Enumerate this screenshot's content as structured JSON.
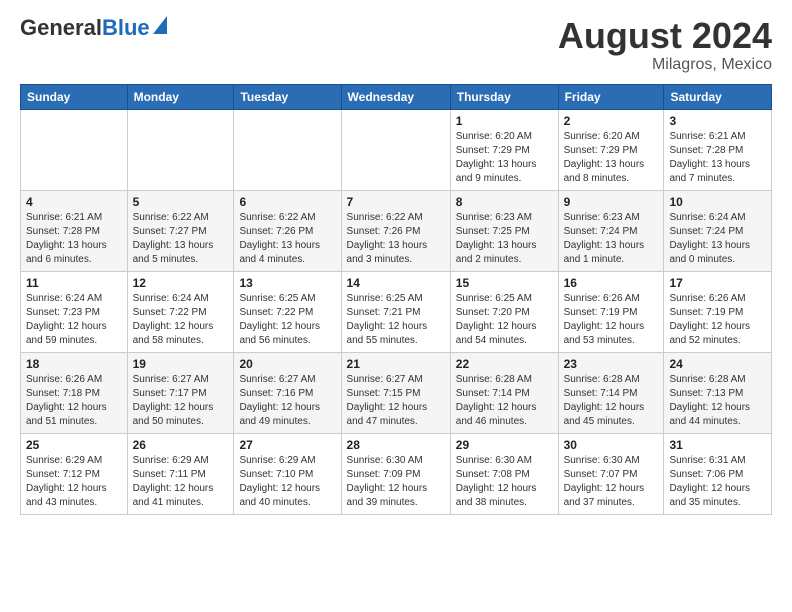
{
  "header": {
    "logo_general": "General",
    "logo_blue": "Blue",
    "month_title": "August 2024",
    "location": "Milagros, Mexico"
  },
  "days_of_week": [
    "Sunday",
    "Monday",
    "Tuesday",
    "Wednesday",
    "Thursday",
    "Friday",
    "Saturday"
  ],
  "weeks": [
    [
      {
        "day": "",
        "info": ""
      },
      {
        "day": "",
        "info": ""
      },
      {
        "day": "",
        "info": ""
      },
      {
        "day": "",
        "info": ""
      },
      {
        "day": "1",
        "info": "Sunrise: 6:20 AM\nSunset: 7:29 PM\nDaylight: 13 hours\nand 9 minutes."
      },
      {
        "day": "2",
        "info": "Sunrise: 6:20 AM\nSunset: 7:29 PM\nDaylight: 13 hours\nand 8 minutes."
      },
      {
        "day": "3",
        "info": "Sunrise: 6:21 AM\nSunset: 7:28 PM\nDaylight: 13 hours\nand 7 minutes."
      }
    ],
    [
      {
        "day": "4",
        "info": "Sunrise: 6:21 AM\nSunset: 7:28 PM\nDaylight: 13 hours\nand 6 minutes."
      },
      {
        "day": "5",
        "info": "Sunrise: 6:22 AM\nSunset: 7:27 PM\nDaylight: 13 hours\nand 5 minutes."
      },
      {
        "day": "6",
        "info": "Sunrise: 6:22 AM\nSunset: 7:26 PM\nDaylight: 13 hours\nand 4 minutes."
      },
      {
        "day": "7",
        "info": "Sunrise: 6:22 AM\nSunset: 7:26 PM\nDaylight: 13 hours\nand 3 minutes."
      },
      {
        "day": "8",
        "info": "Sunrise: 6:23 AM\nSunset: 7:25 PM\nDaylight: 13 hours\nand 2 minutes."
      },
      {
        "day": "9",
        "info": "Sunrise: 6:23 AM\nSunset: 7:24 PM\nDaylight: 13 hours\nand 1 minute."
      },
      {
        "day": "10",
        "info": "Sunrise: 6:24 AM\nSunset: 7:24 PM\nDaylight: 13 hours\nand 0 minutes."
      }
    ],
    [
      {
        "day": "11",
        "info": "Sunrise: 6:24 AM\nSunset: 7:23 PM\nDaylight: 12 hours\nand 59 minutes."
      },
      {
        "day": "12",
        "info": "Sunrise: 6:24 AM\nSunset: 7:22 PM\nDaylight: 12 hours\nand 58 minutes."
      },
      {
        "day": "13",
        "info": "Sunrise: 6:25 AM\nSunset: 7:22 PM\nDaylight: 12 hours\nand 56 minutes."
      },
      {
        "day": "14",
        "info": "Sunrise: 6:25 AM\nSunset: 7:21 PM\nDaylight: 12 hours\nand 55 minutes."
      },
      {
        "day": "15",
        "info": "Sunrise: 6:25 AM\nSunset: 7:20 PM\nDaylight: 12 hours\nand 54 minutes."
      },
      {
        "day": "16",
        "info": "Sunrise: 6:26 AM\nSunset: 7:19 PM\nDaylight: 12 hours\nand 53 minutes."
      },
      {
        "day": "17",
        "info": "Sunrise: 6:26 AM\nSunset: 7:19 PM\nDaylight: 12 hours\nand 52 minutes."
      }
    ],
    [
      {
        "day": "18",
        "info": "Sunrise: 6:26 AM\nSunset: 7:18 PM\nDaylight: 12 hours\nand 51 minutes."
      },
      {
        "day": "19",
        "info": "Sunrise: 6:27 AM\nSunset: 7:17 PM\nDaylight: 12 hours\nand 50 minutes."
      },
      {
        "day": "20",
        "info": "Sunrise: 6:27 AM\nSunset: 7:16 PM\nDaylight: 12 hours\nand 49 minutes."
      },
      {
        "day": "21",
        "info": "Sunrise: 6:27 AM\nSunset: 7:15 PM\nDaylight: 12 hours\nand 47 minutes."
      },
      {
        "day": "22",
        "info": "Sunrise: 6:28 AM\nSunset: 7:14 PM\nDaylight: 12 hours\nand 46 minutes."
      },
      {
        "day": "23",
        "info": "Sunrise: 6:28 AM\nSunset: 7:14 PM\nDaylight: 12 hours\nand 45 minutes."
      },
      {
        "day": "24",
        "info": "Sunrise: 6:28 AM\nSunset: 7:13 PM\nDaylight: 12 hours\nand 44 minutes."
      }
    ],
    [
      {
        "day": "25",
        "info": "Sunrise: 6:29 AM\nSunset: 7:12 PM\nDaylight: 12 hours\nand 43 minutes."
      },
      {
        "day": "26",
        "info": "Sunrise: 6:29 AM\nSunset: 7:11 PM\nDaylight: 12 hours\nand 41 minutes."
      },
      {
        "day": "27",
        "info": "Sunrise: 6:29 AM\nSunset: 7:10 PM\nDaylight: 12 hours\nand 40 minutes."
      },
      {
        "day": "28",
        "info": "Sunrise: 6:30 AM\nSunset: 7:09 PM\nDaylight: 12 hours\nand 39 minutes."
      },
      {
        "day": "29",
        "info": "Sunrise: 6:30 AM\nSunset: 7:08 PM\nDaylight: 12 hours\nand 38 minutes."
      },
      {
        "day": "30",
        "info": "Sunrise: 6:30 AM\nSunset: 7:07 PM\nDaylight: 12 hours\nand 37 minutes."
      },
      {
        "day": "31",
        "info": "Sunrise: 6:31 AM\nSunset: 7:06 PM\nDaylight: 12 hours\nand 35 minutes."
      }
    ]
  ]
}
